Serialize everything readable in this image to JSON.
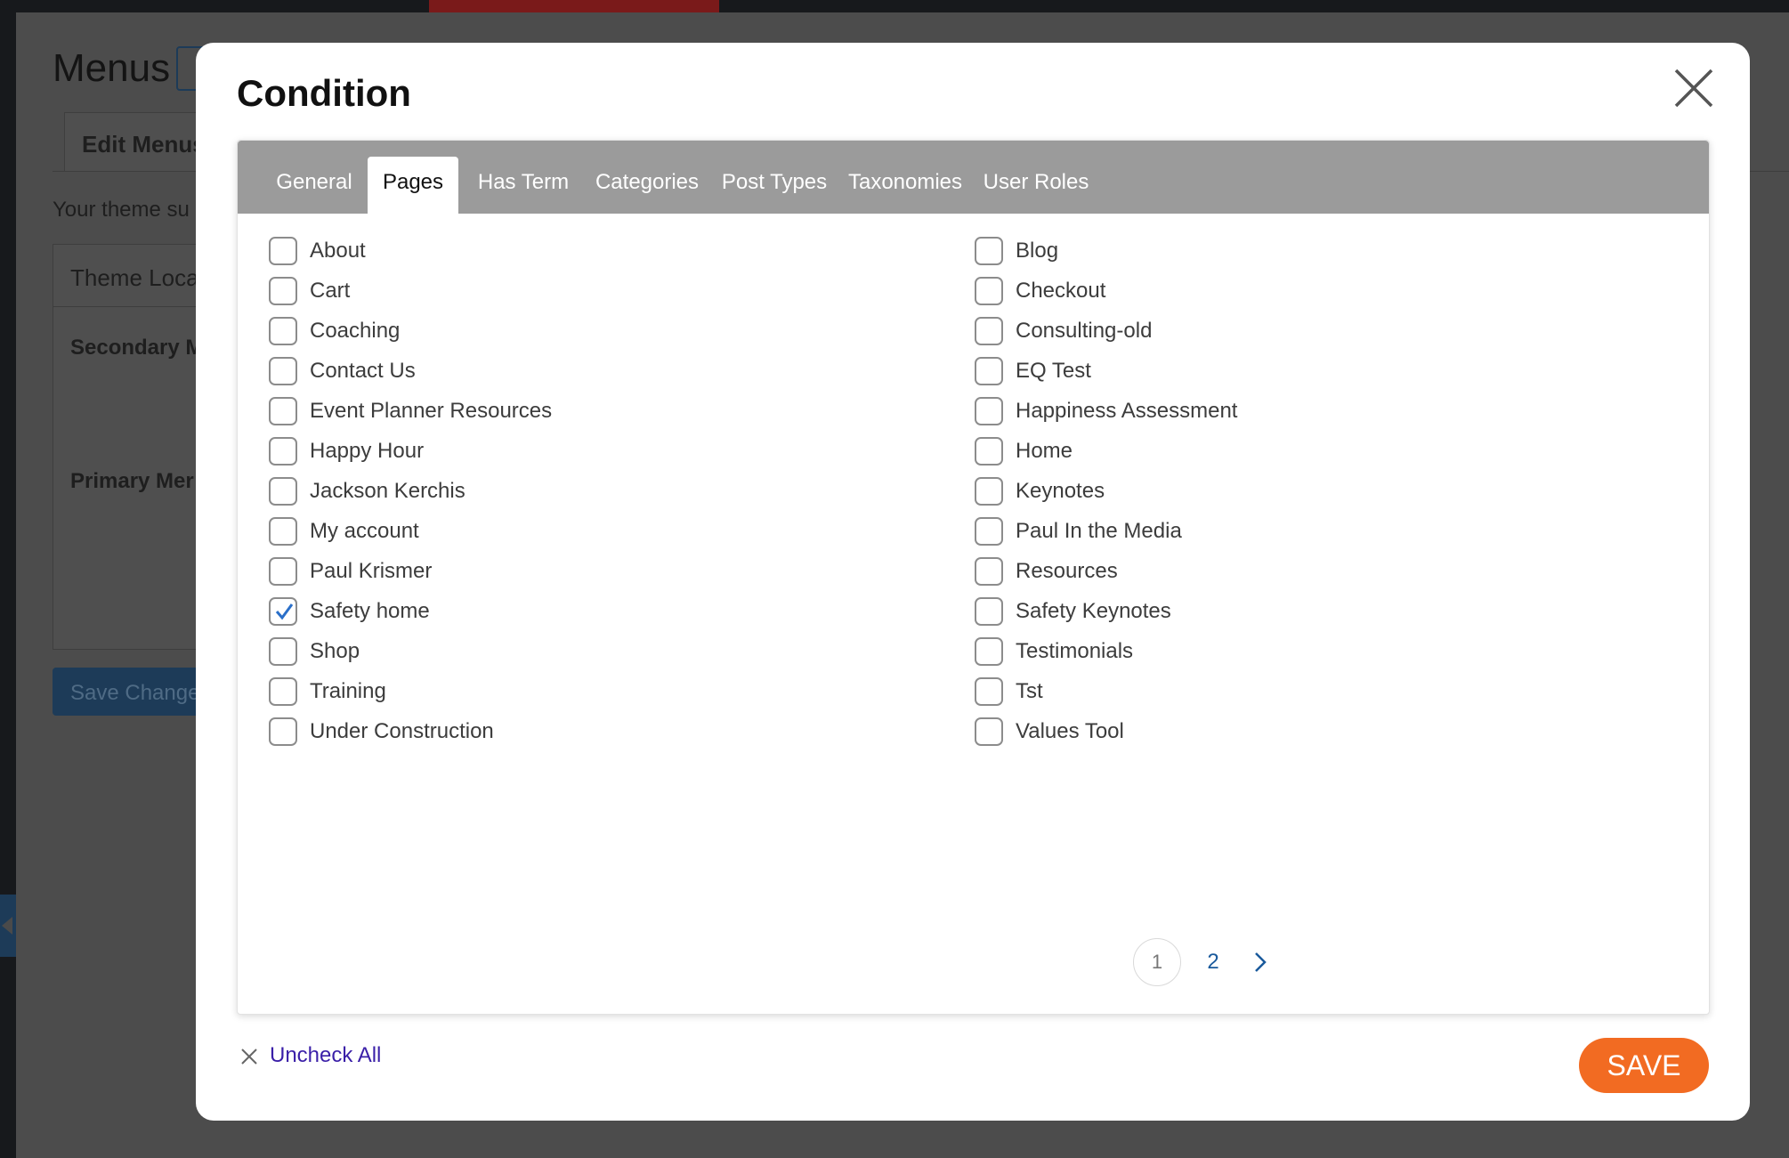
{
  "background": {
    "page_title": "Menus",
    "tab_label": "Edit Menus",
    "description": "Your theme su",
    "box_header": "Theme Loca",
    "secondary_label": "Secondary M",
    "primary_label": "Primary Mer",
    "save_label": "Save Change"
  },
  "modal": {
    "title": "Condition",
    "tabs": [
      {
        "label": "General",
        "active": false
      },
      {
        "label": "Pages",
        "active": true
      },
      {
        "label": "Has Term",
        "active": false
      },
      {
        "label": "Categories",
        "active": false
      },
      {
        "label": "Post Types",
        "active": false
      },
      {
        "label": "Taxonomies",
        "active": false
      },
      {
        "label": "User Roles",
        "active": false
      }
    ],
    "pages_left": [
      {
        "label": "About",
        "checked": false
      },
      {
        "label": "Cart",
        "checked": false
      },
      {
        "label": "Coaching",
        "checked": false
      },
      {
        "label": "Contact Us",
        "checked": false
      },
      {
        "label": "Event Planner Resources",
        "checked": false
      },
      {
        "label": "Happy Hour",
        "checked": false
      },
      {
        "label": "Jackson Kerchis",
        "checked": false
      },
      {
        "label": "My account",
        "checked": false
      },
      {
        "label": "Paul Krismer",
        "checked": false
      },
      {
        "label": "Safety home",
        "checked": true
      },
      {
        "label": "Shop",
        "checked": false
      },
      {
        "label": "Training",
        "checked": false
      },
      {
        "label": "Under Construction",
        "checked": false
      }
    ],
    "pages_right": [
      {
        "label": "Blog",
        "checked": false
      },
      {
        "label": "Checkout",
        "checked": false
      },
      {
        "label": "Consulting-old",
        "checked": false
      },
      {
        "label": "EQ Test",
        "checked": false
      },
      {
        "label": "Happiness Assessment",
        "checked": false
      },
      {
        "label": "Home",
        "checked": false
      },
      {
        "label": "Keynotes",
        "checked": false
      },
      {
        "label": "Paul In the Media",
        "checked": false
      },
      {
        "label": "Resources",
        "checked": false
      },
      {
        "label": "Safety Keynotes",
        "checked": false
      },
      {
        "label": "Testimonials",
        "checked": false
      },
      {
        "label": "Tst",
        "checked": false
      },
      {
        "label": "Values Tool",
        "checked": false
      }
    ],
    "pagination": {
      "current": "1",
      "next_page": "2",
      "next_icon": "chevron-right-icon"
    },
    "uncheck_all_label": "Uncheck All",
    "save_label": "SAVE",
    "colors": {
      "accent": "#f26b22",
      "tabbar": "#9b9b9b",
      "link": "#3a1fa8",
      "checkmark": "#2a6fc9"
    }
  }
}
